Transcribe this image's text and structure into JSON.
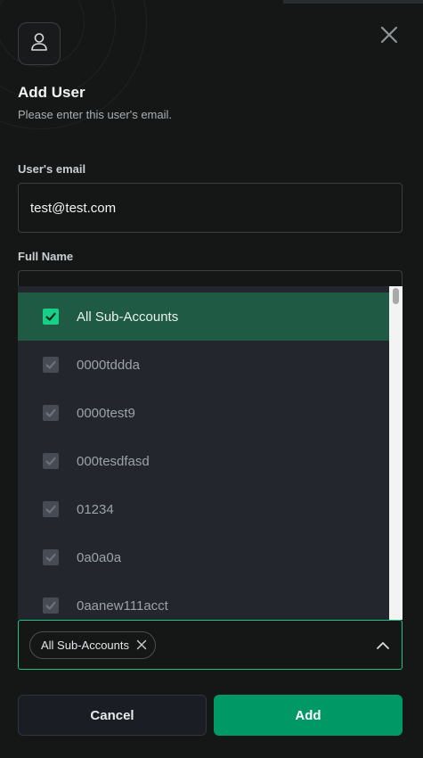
{
  "colors": {
    "accent": "#009966",
    "checkbox_checked": "#17d088",
    "selected_row": "#1f5a44",
    "focus_border": "#1cc47e"
  },
  "header": {
    "avatar_icon": "user-icon",
    "close_icon": "close-icon",
    "title": "Add User",
    "subtitle": "Please enter this user's email."
  },
  "form": {
    "email_label": "User's email",
    "email_value": "test@test.com",
    "fullname_label": "Full Name",
    "fullname_value": ""
  },
  "dropdown": {
    "items": [
      {
        "label": "All Sub-Accounts",
        "checked": true,
        "selected": true
      },
      {
        "label": "0000tddda",
        "checked": true,
        "selected": false
      },
      {
        "label": "0000test9",
        "checked": true,
        "selected": false
      },
      {
        "label": "000tesdfasd",
        "checked": true,
        "selected": false
      },
      {
        "label": "01234",
        "checked": true,
        "selected": false
      },
      {
        "label": "0a0a0a",
        "checked": true,
        "selected": false
      },
      {
        "label": "0aanew111acct",
        "checked": true,
        "selected": false
      }
    ]
  },
  "select": {
    "chip_label": "All Sub-Accounts",
    "chevron_icon": "chevron-up-icon"
  },
  "actions": {
    "cancel_label": "Cancel",
    "add_label": "Add"
  }
}
